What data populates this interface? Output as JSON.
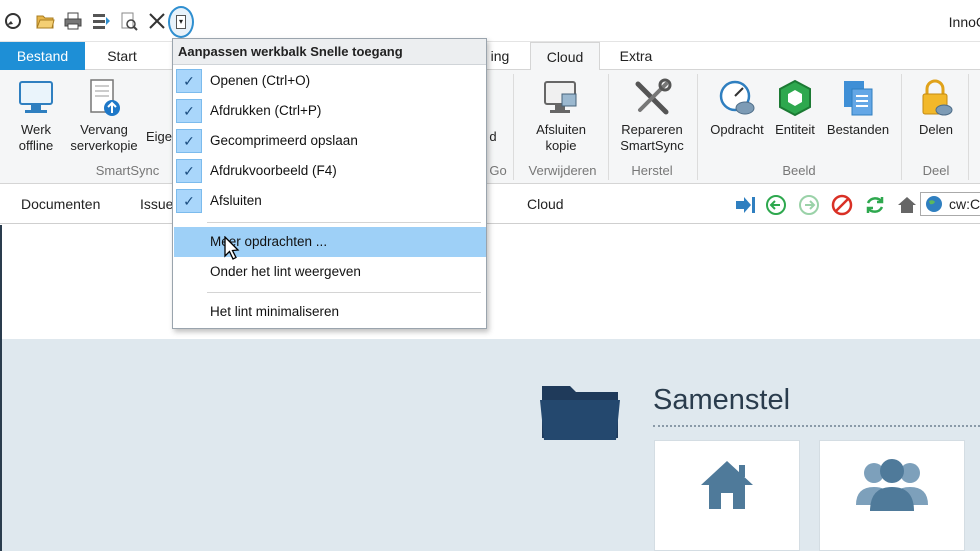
{
  "app": {
    "title": "InnoC"
  },
  "qat": {
    "icons": [
      "refresh-icon",
      "open-folder-icon",
      "print-icon",
      "compress-icon",
      "print-preview-icon",
      "close-icon",
      "customize-dropdown-icon"
    ]
  },
  "tabs": {
    "file": "Bestand",
    "start": "Start",
    "hidden_partial": "ing",
    "cloud": "Cloud",
    "extra": "Extra"
  },
  "ribbon": {
    "work_offline": [
      "Werk",
      "offline"
    ],
    "replace_server_copy": [
      "Vervang",
      "serverkopie"
    ],
    "own_partial": "Eige",
    "group_smartsync": "SmartSync",
    "d_partial": "d",
    "go_partial": "Go",
    "close_copy": [
      "Afsluiten",
      "kopie"
    ],
    "group_remove": "Verwijderen",
    "repair_smartsync": [
      "Repareren",
      "SmartSync"
    ],
    "group_restore": "Herstel",
    "assignment": "Opdracht",
    "entity": "Entiteit",
    "files": "Bestanden",
    "group_view": "Beeld",
    "share": "Delen",
    "group_share": "Deel"
  },
  "subbar": {
    "documents": "Documenten",
    "issues_partial": "Issue",
    "cloud": "Cloud",
    "address": "cw:C"
  },
  "menu": {
    "header": "Aanpassen werkbalk Snelle toegang",
    "items": [
      {
        "label": "Openen (Ctrl+O)",
        "checked": true
      },
      {
        "label": "Afdrukken (Ctrl+P)",
        "checked": true
      },
      {
        "label": "Gecomprimeerd opslaan",
        "checked": true
      },
      {
        "label": "Afdrukvoorbeeld (F4)",
        "checked": true
      },
      {
        "label": "Afsluiten",
        "checked": true
      }
    ],
    "more_commands": "Meer opdrachten ...",
    "show_below_ribbon": "Onder het lint weergeven",
    "minimize_ribbon": "Het lint minimaliseren",
    "check_glyph": "✓"
  },
  "content": {
    "section_title": "Samenstel"
  },
  "colors": {
    "accent": "#1e8fd6",
    "menu_hover": "#9ed0f7",
    "check_bg": "#a9d6fb",
    "dark_navy": "#1f3a5a",
    "tile_icon": "#4f7a9a"
  }
}
